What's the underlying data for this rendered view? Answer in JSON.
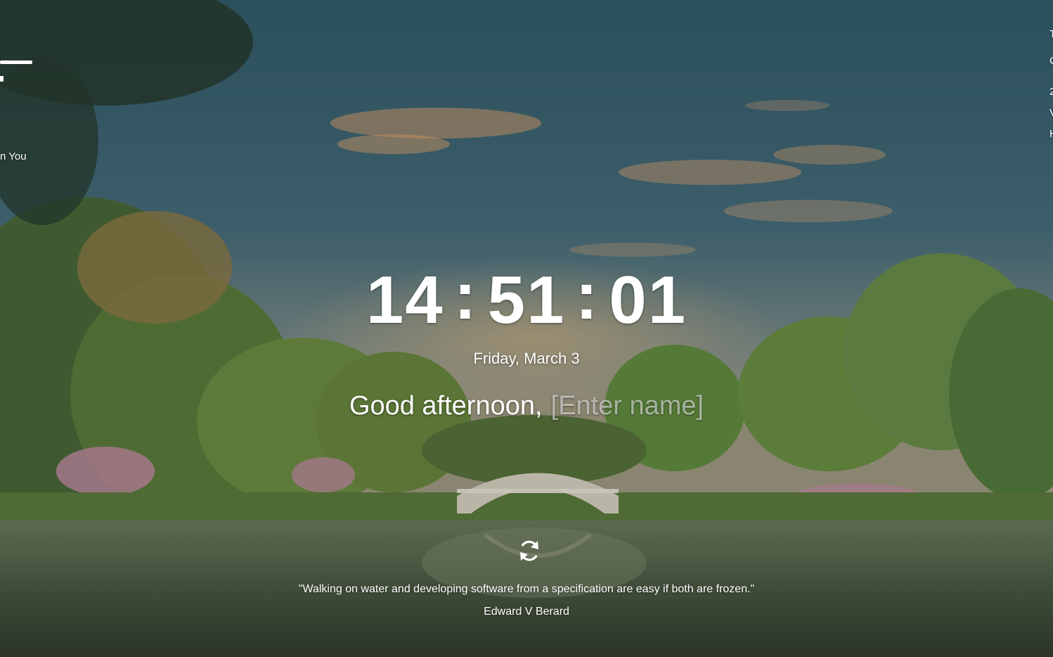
{
  "clock": {
    "hours": "14",
    "minutes": "51",
    "seconds": "01",
    "separator": ":"
  },
  "date": "Friday, March 3",
  "greeting": {
    "text": "Good afternoon,",
    "name_placeholder": "[Enter name]"
  },
  "quote": {
    "text": "\"Walking on water and developing software from a specification are easy if both are frozen.\"",
    "author": "Edward V Berard"
  },
  "left_widget": {
    "label": "n You"
  },
  "right_widget": {
    "lines": [
      "T",
      "C",
      "2",
      "V",
      "H"
    ]
  },
  "icons": {
    "refresh": "refresh-icon"
  },
  "colors": {
    "text": "#ffffff",
    "placeholder": "rgba(255,255,255,0.55)"
  }
}
